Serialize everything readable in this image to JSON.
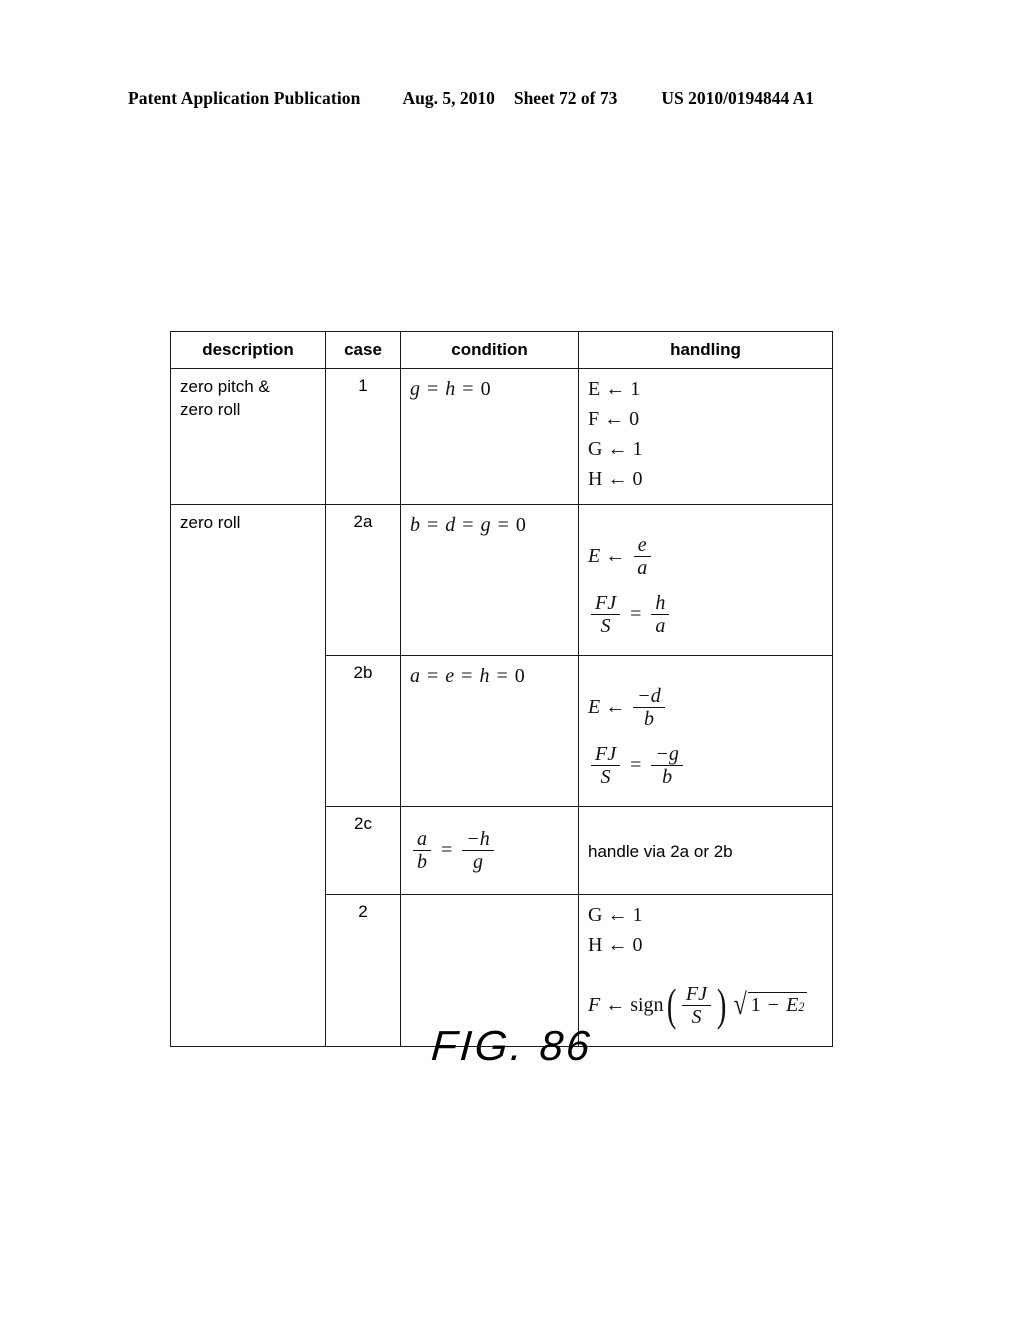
{
  "header": {
    "title": "Patent Application Publication",
    "date": "Aug. 5, 2010",
    "sheet": "Sheet 72 of 73",
    "publication_number": "US 2010/0194844 A1"
  },
  "table": {
    "columns": [
      "description",
      "case",
      "condition",
      "handling"
    ],
    "rows": [
      {
        "description": "zero pitch &\nzero roll",
        "case": "1",
        "condition": {
          "type": "equation",
          "lhs": "g",
          "mid": "h",
          "rhs": "0"
        },
        "handling": {
          "type": "assignments",
          "lines": [
            "E ← 1",
            "F ← 0",
            "G ← 1",
            "H ← 0"
          ]
        }
      },
      {
        "description": "zero roll",
        "case": "2a",
        "condition": {
          "type": "equation4",
          "terms": [
            "b",
            "d",
            "g",
            "0"
          ]
        },
        "handling": {
          "type": "fractions",
          "line1": {
            "lead": "E",
            "rel": "←",
            "num": "e",
            "den": "a"
          },
          "line2": {
            "lead_num": "FJ",
            "lead_den": "S",
            "rel": "=",
            "num": "h",
            "den": "a"
          }
        }
      },
      {
        "description": "",
        "case": "2b",
        "condition": {
          "type": "equation4",
          "terms": [
            "a",
            "e",
            "h",
            "0"
          ]
        },
        "handling": {
          "type": "fractions",
          "line1": {
            "lead": "E",
            "rel": "←",
            "num": "−d",
            "den": "b"
          },
          "line2": {
            "lead_num": "FJ",
            "lead_den": "S",
            "rel": "=",
            "num": "−g",
            "den": "b"
          }
        }
      },
      {
        "description": "",
        "case": "2c",
        "condition": {
          "type": "fraction_equation",
          "lnum": "a",
          "lden": "b",
          "rel": "=",
          "rnum": "−h",
          "rden": "g"
        },
        "handling": {
          "type": "text",
          "text": "handle via 2a or 2b"
        }
      },
      {
        "description": "",
        "case": "2",
        "condition": {
          "type": "empty"
        },
        "handling": {
          "type": "signformula",
          "lines": [
            "G ← 1",
            "H ← 0"
          ],
          "formula": {
            "lead": "F",
            "arrow": "←",
            "fn": "sign",
            "arg_num": "FJ",
            "arg_den": "S",
            "radicand_one": "1",
            "radicand_op": "−",
            "radicand_var": "E",
            "radicand_exp": "2"
          }
        }
      }
    ]
  },
  "figure": {
    "caption": "FIG. 86"
  }
}
